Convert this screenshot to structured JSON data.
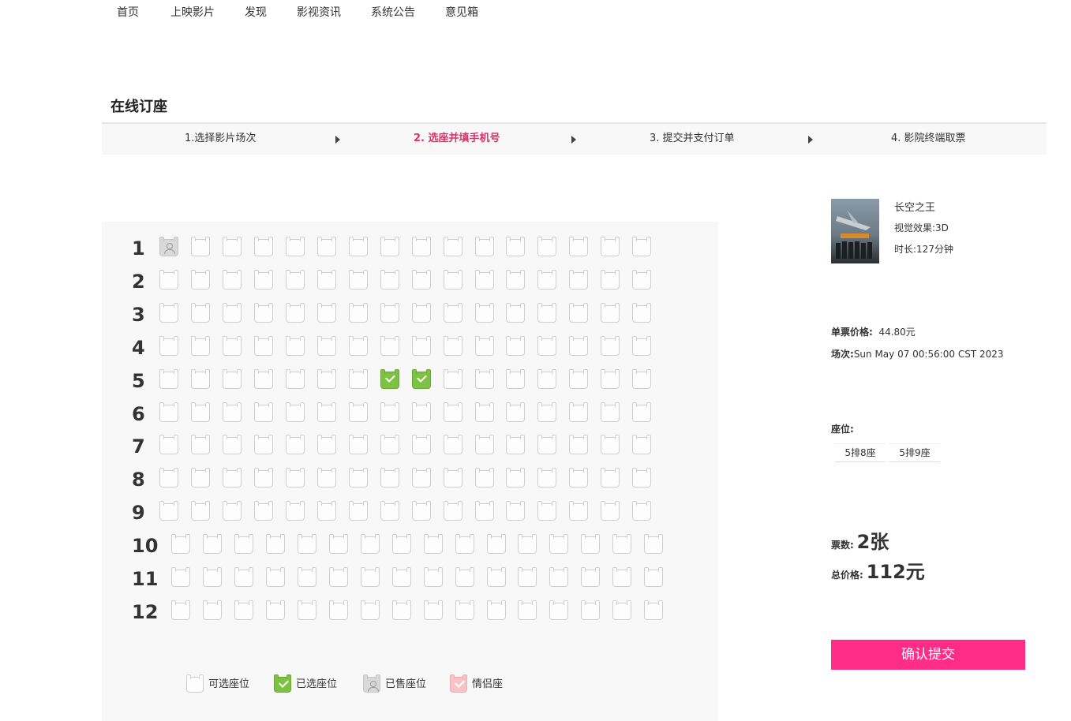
{
  "nav": [
    "首页",
    "上映影片",
    "发现",
    "影视资讯",
    "系统公告",
    "意见箱"
  ],
  "page_title": "在线订座",
  "steps": [
    "1.选择影片场次",
    "2. 选座并填手机号",
    "3. 提交并支付订单",
    "4. 影院终端取票"
  ],
  "active_step": 1,
  "seat_map": {
    "row_labels": [
      "1",
      "2",
      "3",
      "4",
      "5",
      "6",
      "7",
      "8",
      "9",
      "10",
      "11",
      "12"
    ],
    "seats_per_row": 16,
    "sold": [
      [
        1,
        1
      ]
    ],
    "selected": [
      [
        5,
        8
      ],
      [
        5,
        9
      ]
    ]
  },
  "legend": [
    "可选座位",
    "已选座位",
    "已售座位",
    "情侣座"
  ],
  "movie": {
    "title": "长空之王",
    "effect_label": "视觉效果:",
    "effect": "3D",
    "duration_label": "时长:",
    "duration": "127分钟"
  },
  "price": {
    "label": "单票价格:",
    "value": "44.80元"
  },
  "session": {
    "label": "场次:",
    "value": "Sun May 07 00:56:00 CST 2023"
  },
  "seats": {
    "label": "座位:",
    "items": [
      "5排8座",
      "5排9座"
    ]
  },
  "tickets": {
    "label": "票数:",
    "value": "2张"
  },
  "total": {
    "label": "总价格:",
    "value": "112元"
  },
  "submit_label": "确认提交",
  "colors": {
    "accent": "#ff2d87",
    "active_step": "#e0306b",
    "selected_seat": "#7dc243"
  }
}
